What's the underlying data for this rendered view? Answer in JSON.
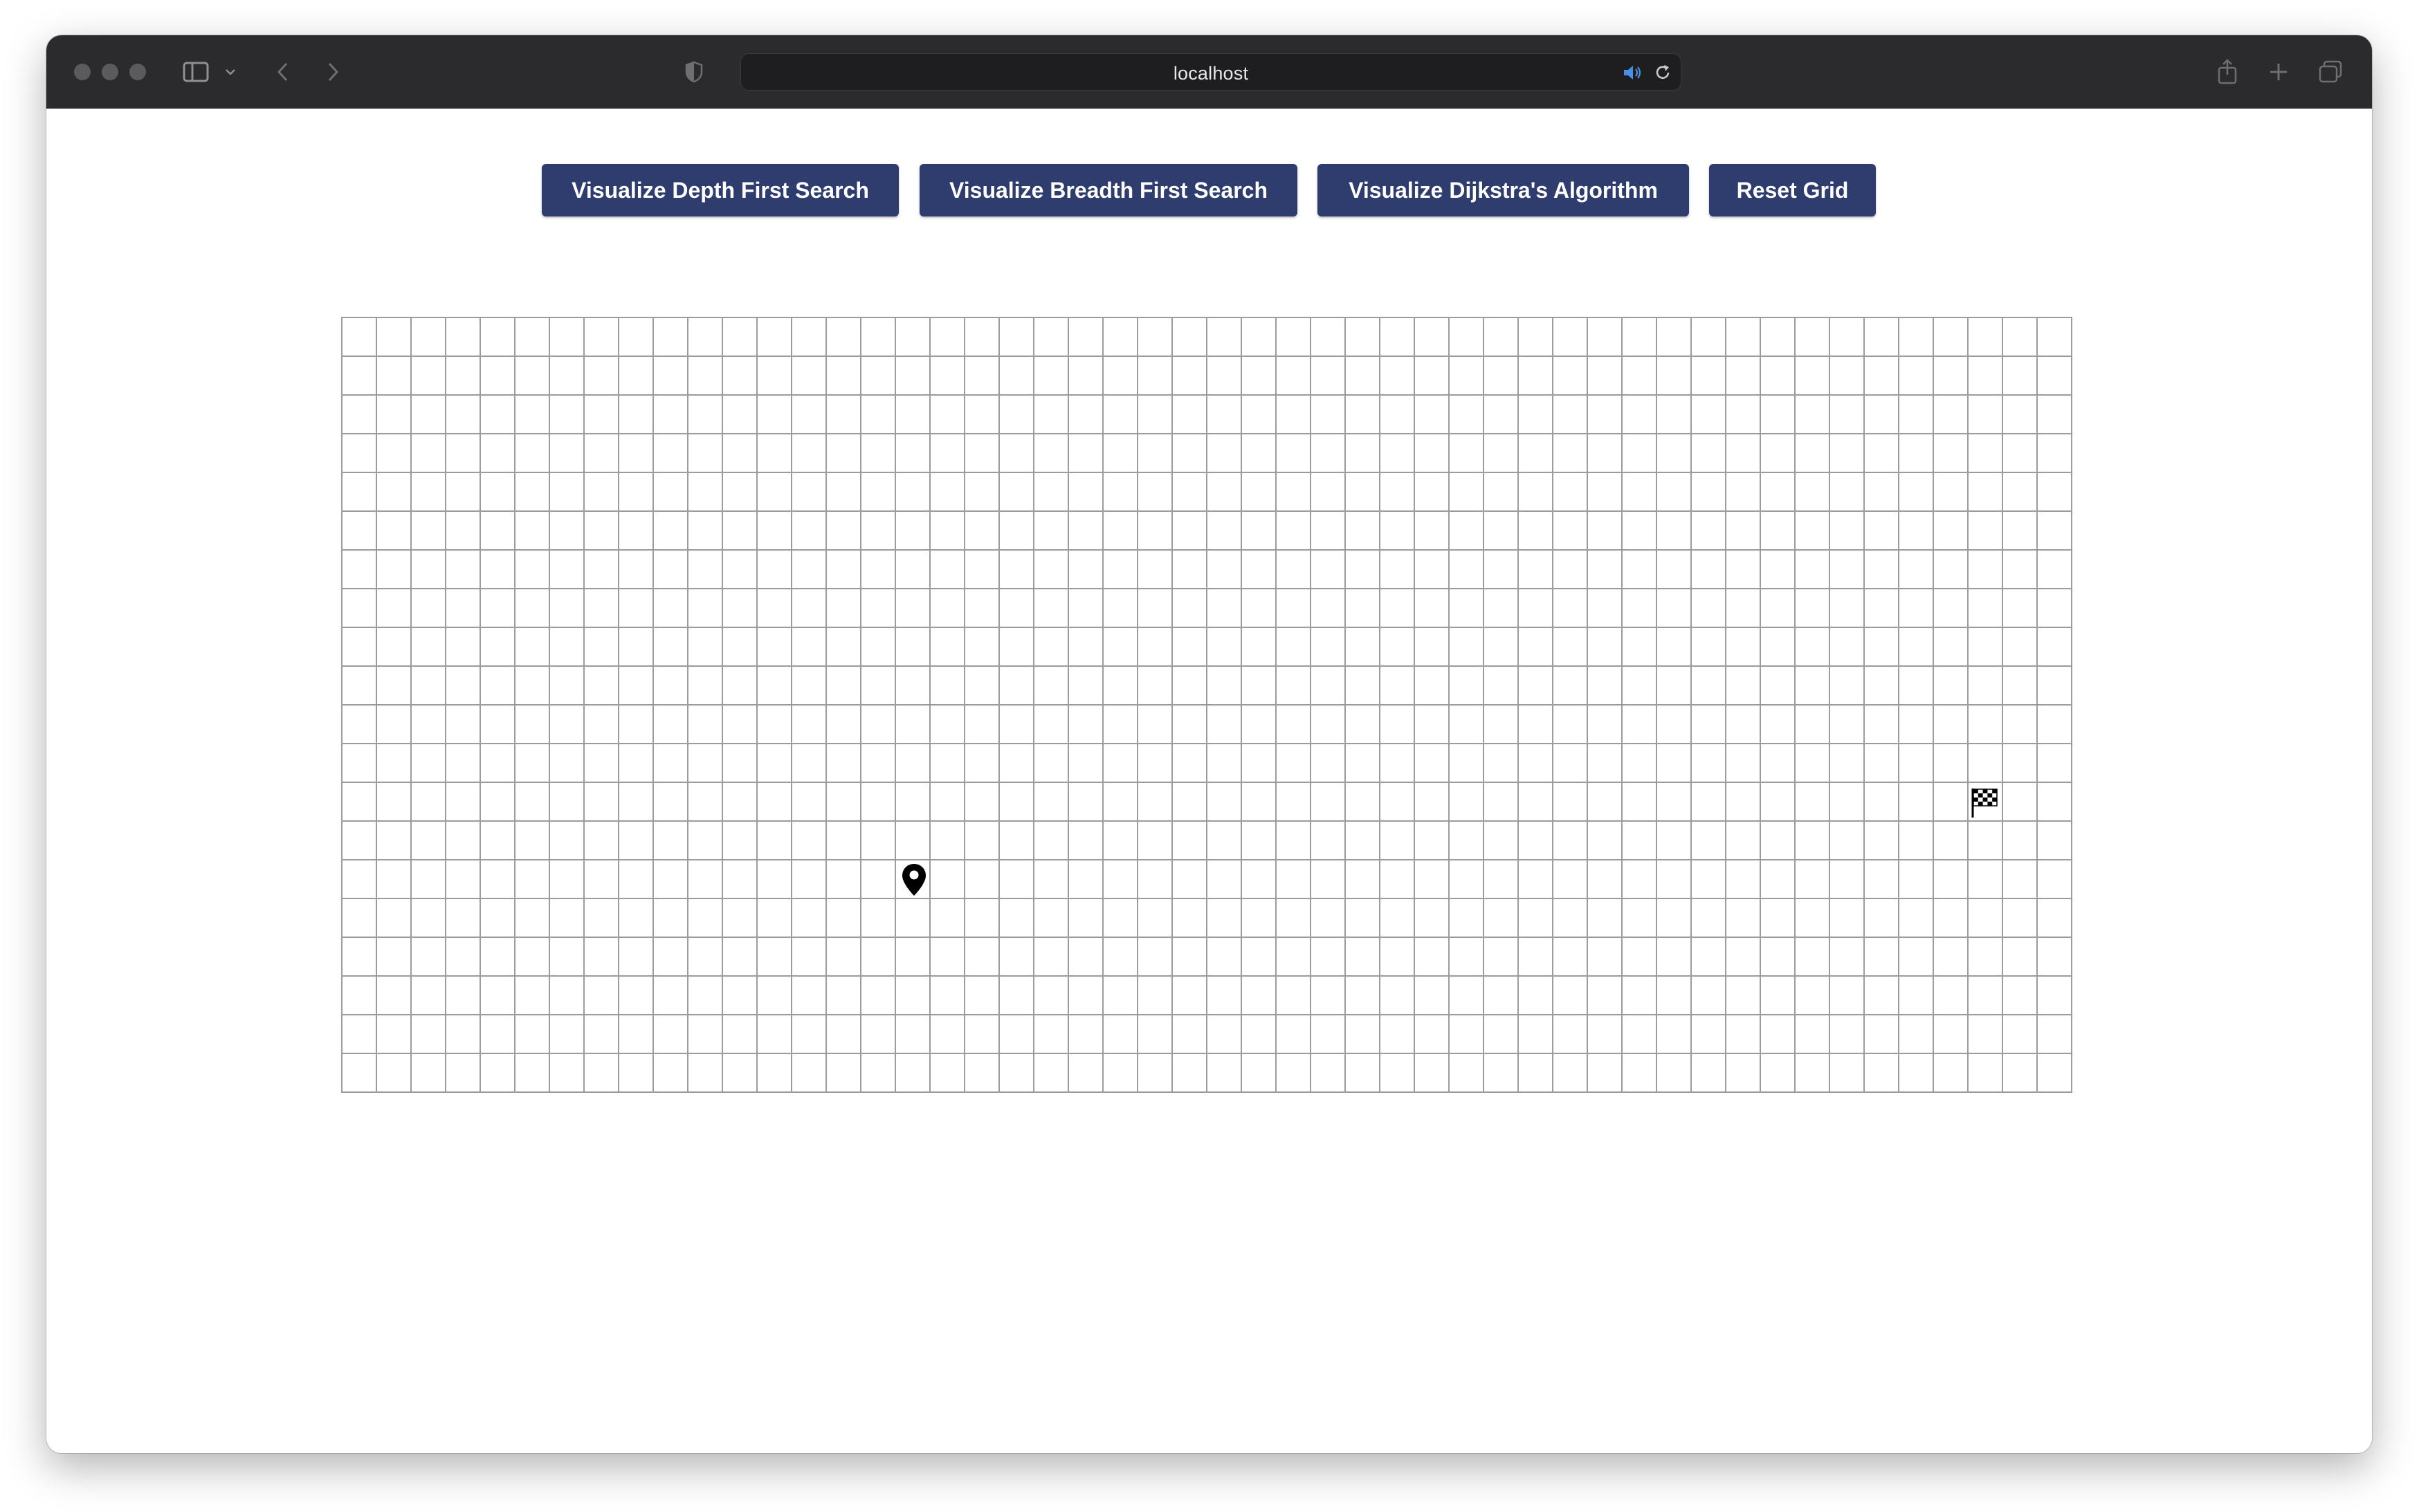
{
  "browser": {
    "address": "localhost",
    "icons": [
      "sidebar-icon",
      "chevron-down-icon",
      "back-arrow-icon",
      "forward-arrow-icon",
      "shield-icon",
      "extension-icon",
      "speaker-icon",
      "reload-icon",
      "share-icon",
      "new-tab-plus-icon",
      "tab-overview-icon"
    ]
  },
  "controls": {
    "dfs_label": "Visualize Depth First Search",
    "bfs_label": "Visualize Breadth First Search",
    "dijkstra_label": "Visualize Dijkstra's Algorithm",
    "reset_label": "Reset Grid"
  },
  "grid": {
    "rows": 20,
    "cols": 50,
    "start": {
      "row": 14,
      "col": 16,
      "icon": "map-pin-icon"
    },
    "finish": {
      "row": 12,
      "col": 47,
      "icon": "checkered-flag-icon"
    }
  },
  "colors": {
    "button_bg": "#2e3d6e",
    "grid_line": "#9c9c9c",
    "toolbar_bg": "#2b2b2d"
  }
}
